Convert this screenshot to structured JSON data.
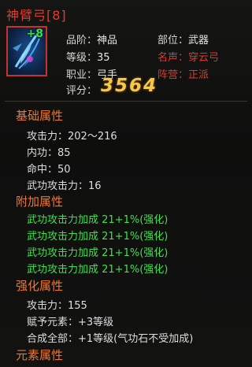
{
  "item": {
    "name": "神臂弓[8]",
    "enhance_badge": "+8",
    "icon": "bow-icon",
    "grade_label": "品阶：",
    "grade_value": "神品",
    "slot_label": "部位：",
    "slot_value": "武器",
    "level_label": "等级：",
    "level_value": "35",
    "fame_label": "名声：",
    "fame_value": "穿云弓",
    "class_label": "职业：",
    "class_value": "弓手",
    "faction_label": "阵营：",
    "faction_value": "正派",
    "score_label": "评分：",
    "score_value": "3564"
  },
  "base_attrs": {
    "title": "基础属性",
    "lines": [
      "攻击力：202～216",
      "内功：85",
      "命中：50",
      "武功攻击力：16"
    ]
  },
  "extra_attrs": {
    "title": "附加属性",
    "lines": [
      "武功攻击力加成  21+1%(强化)",
      "武功攻击力加成  21+1%(强化)",
      "武功攻击力加成  21+1%(强化)",
      "武功攻击力加成  21+1%(强化)"
    ]
  },
  "enhance_attrs": {
    "title": "强化属性",
    "lines": [
      "攻击力：155",
      "赋予元素：+3等级",
      "合成全部：+1等级(气功石不受加成)"
    ]
  },
  "element_attrs": {
    "title": "元素属性"
  },
  "colors": {
    "title": "#e23b32",
    "section": "#e9783a",
    "bonus": "#3fe04e",
    "score": "#f2c94a",
    "icon_border": "#c8322b"
  }
}
